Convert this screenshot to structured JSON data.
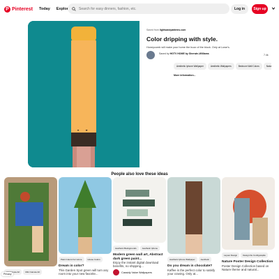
{
  "header": {
    "logo_text": "Pinterest",
    "nav": [
      "Today",
      "Explore"
    ],
    "search_placeholder": "Search for easy dinners, fashion, etc.",
    "login_label": "Log in",
    "signup_label": "Sign up",
    "colors": {
      "brand": "#e60023",
      "search_bg": "#efefef"
    }
  },
  "pin": {
    "source_prefix": "Saved from",
    "source_domain": "lightsandpatterns.com",
    "title": "Color dripping with style.",
    "description": "Honeycomb will make your home the buzz of the block. Only at Lowe's.",
    "saved_prefix": "Saved by",
    "saved_by": "HGTV HOME by Sherwin-Williams",
    "save_count": "7.4k",
    "tags": [
      "Aesthetic Iphone Wallpaper",
      "Aesthetic Wallpapers",
      "Bedroom Wall Colors",
      "Nature"
    ],
    "more_label": "More information..."
  },
  "related": {
    "title": "People also love these ideas",
    "cards": [
      {
        "chips": [
          "Art Canvas Art",
          "Mini Canvas Art"
        ],
        "title": "",
        "desc": "",
        "user": ""
      },
      {
        "chips": [
          "Paint Colors For Home",
          "House Colors"
        ],
        "title": "Dream in color?",
        "desc": "This Garden Spot green will turn any room into your new favorite...",
        "user": ""
      },
      {
        "chips": [
          "Aesthetic Backgrounds",
          "Aesthetic Iphone"
        ],
        "title": "Modern green wall art, Abstract dark green paint...",
        "desc": "Enjoy the instant digital download benefits, no shipping...",
        "user": "Cassidy Valoe Wallpapers"
      },
      {
        "chips": [
          "Aesthetic Iphone Wallpaper",
          "Aesthetic"
        ],
        "title": "Do you dream in chocolate?",
        "desc": "Kaffee is the perfect color to satisfy your craving. Only at...",
        "user": ""
      },
      {
        "chips": [
          "Layout Design",
          "Design De Configuração"
        ],
        "title": "Nature Poster Design Collection",
        "desc": "Poster Design Collection based on Nature theme and natural...",
        "user": ""
      }
    ]
  },
  "footer": {
    "privacy_label": "Privacy"
  }
}
